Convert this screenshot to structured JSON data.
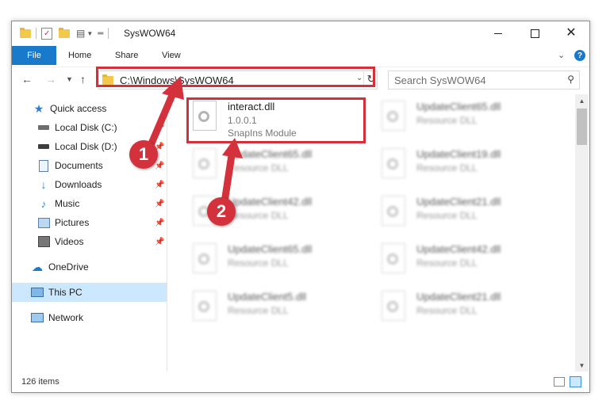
{
  "window": {
    "title": "SysWOW64"
  },
  "ribbon": {
    "file": "File",
    "tabs": [
      "Home",
      "Share",
      "View"
    ],
    "help": "?"
  },
  "address": {
    "path": "C:\\Windows\\SysWOW64",
    "search_placeholder": "Search SysWOW64"
  },
  "nav": {
    "items": [
      {
        "label": "Quick access",
        "icon": "star-icon"
      },
      {
        "label": "Local Disk (C:)",
        "icon": "drive-icon"
      },
      {
        "label": "Local Disk (D:)",
        "icon": "drive-icon"
      },
      {
        "label": "Documents",
        "icon": "documents-icon"
      },
      {
        "label": "Downloads",
        "icon": "download-icon"
      },
      {
        "label": "Music",
        "icon": "music-icon"
      },
      {
        "label": "Pictures",
        "icon": "pictures-icon"
      },
      {
        "label": "Videos",
        "icon": "videos-icon"
      },
      {
        "label": "OneDrive",
        "icon": "cloud-icon"
      },
      {
        "label": "This PC",
        "icon": "computer-icon"
      },
      {
        "label": "Network",
        "icon": "network-icon"
      }
    ]
  },
  "files": {
    "highlighted": {
      "name": "interact.dll",
      "version": "1.0.0.1",
      "description": "SnapIns Module"
    },
    "left_column": [
      {
        "name": "UpdateClient65.dll",
        "description": "Resource DLL"
      },
      {
        "name": "UpdateClient42.dll",
        "description": "Resource DLL"
      },
      {
        "name": "UpdateClient65.dll",
        "description": "Resource DLL"
      },
      {
        "name": "UpdateClient5.dll",
        "description": "Resource DLL"
      }
    ],
    "right_column": [
      {
        "name": "UpdateClient65.dll",
        "description": "Resource DLL"
      },
      {
        "name": "UpdateClient19.dll",
        "description": "Resource DLL"
      },
      {
        "name": "UpdateClient21.dll",
        "description": "Resource DLL"
      },
      {
        "name": "UpdateClient42.dll",
        "description": "Resource DLL"
      },
      {
        "name": "UpdateClient21.dll",
        "description": "Resource DLL"
      }
    ]
  },
  "status": {
    "count": "126 items"
  },
  "callouts": {
    "one": "1",
    "two": "2",
    "color": "#d3323c"
  }
}
